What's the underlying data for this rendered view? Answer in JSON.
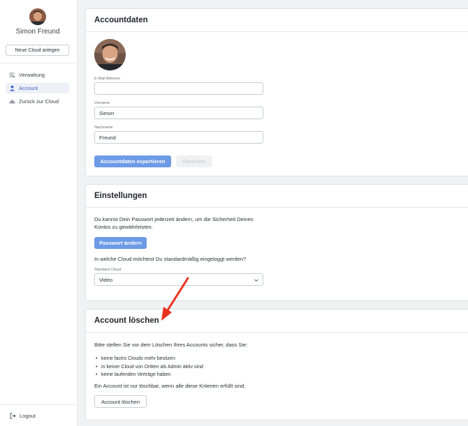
{
  "sidebar": {
    "user_name": "Simon Freund",
    "new_cloud_label": "Neue Cloud anlegen",
    "nav": [
      {
        "label": "Verwaltung",
        "icon": "admin-icon"
      },
      {
        "label": "Account",
        "icon": "user-icon"
      },
      {
        "label": "Zurück zur Cloud",
        "icon": "cloud-icon"
      }
    ],
    "logout_label": "Logout"
  },
  "account": {
    "title": "Accountdaten",
    "email_label": "E-Mail Adresse",
    "email_value": "",
    "first_name_label": "Vorname",
    "first_name_value": "Simon",
    "last_name_label": "Nachname",
    "last_name_value": "Freund",
    "export_label": "Accountdaten exportieren",
    "save_label": "Speichern"
  },
  "settings": {
    "title": "Einstellungen",
    "password_text_1": "Du kannst Dein Passwort jederzeit ändern, um die Sicherheit Deines",
    "password_text_2": "Kontos zu gewährleisten.",
    "password_button": "Passwort ändern",
    "cloud_question": "In welche Cloud möchtest Du standardmäßig eingeloggt werden?",
    "cloud_label": "Standard Cloud",
    "cloud_value": "Video"
  },
  "delete": {
    "title": "Account löschen",
    "intro": "Bitte stellen Sie vor dem Löschen Ihres Accounts sicher, dass Sie:",
    "criteria": [
      "keine factro Clouds mehr besitzen",
      "in keiner Cloud von Dritten als Admin aktiv sind",
      "keine laufenden Verträge haben"
    ],
    "note": "Ein Account ist nur löschbar, wenn alle diese Kriterien erfüllt sind.",
    "button": "Account löschen"
  },
  "colors": {
    "primary": "#6d9be6",
    "active_nav": "#3b63c7",
    "annotation_arrow": "#e8321e"
  }
}
